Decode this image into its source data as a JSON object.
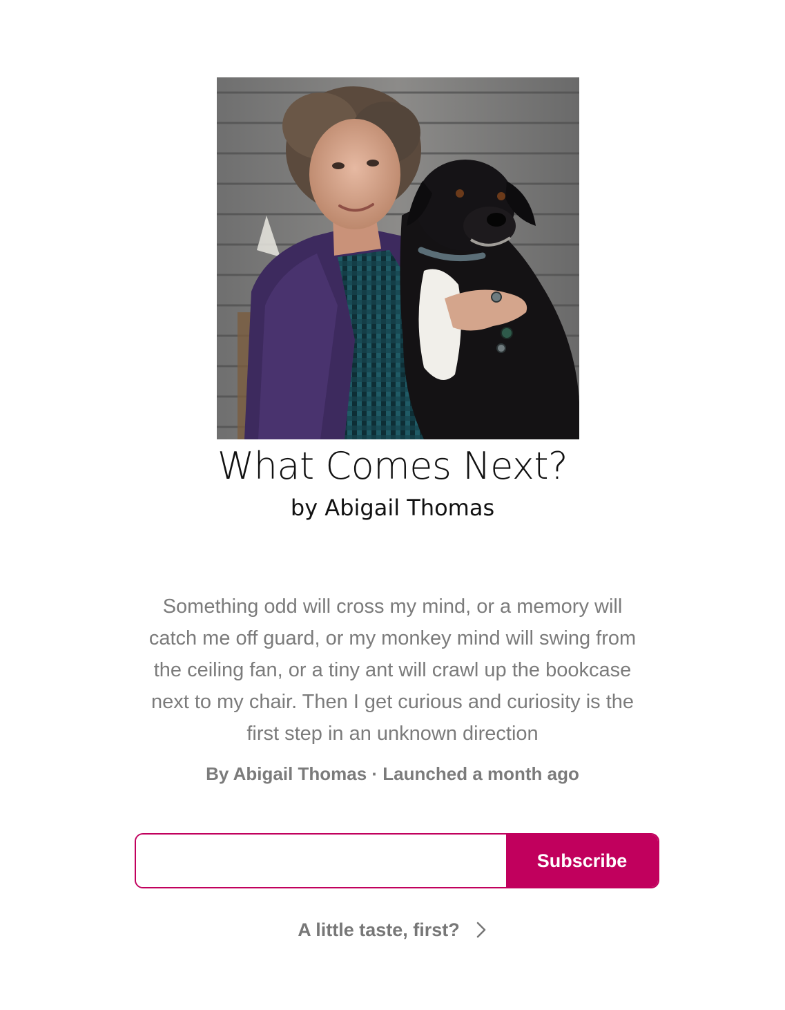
{
  "publication": {
    "title": "What Comes Next?",
    "byline": "by Abigail Thomas",
    "cover_image": "portrait-woman-with-black-dog"
  },
  "about": {
    "description": "Something odd will cross my mind, or a memory will catch me off guard, or my monkey mind will swing from the ceiling fan, or a tiny ant will crawl up the bookcase next to my chair. Then I get curious and curiosity is the first step in an unknown direction",
    "meta": "By Abigail Thomas · Launched a month ago"
  },
  "subscribe": {
    "email_value": "",
    "email_placeholder": "",
    "button_label": "Subscribe"
  },
  "taste": {
    "label": "A little taste, first?",
    "icon": "chevron-right-icon"
  },
  "colors": {
    "accent": "#c1005d",
    "muted_text": "#7b7b7b",
    "title_text": "#111111"
  }
}
